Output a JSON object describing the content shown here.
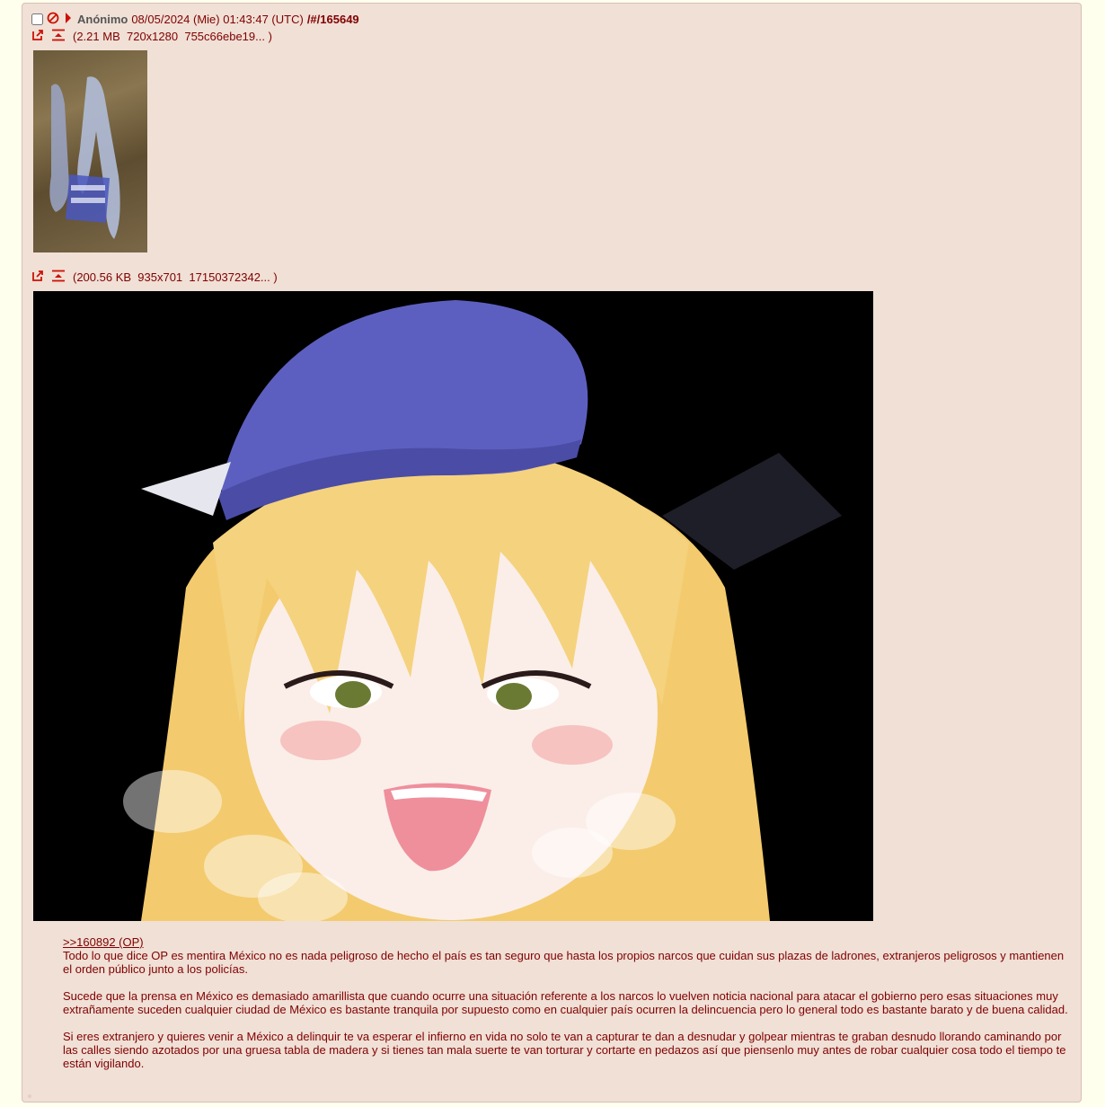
{
  "post": {
    "name": "Anónimo",
    "date": "08/05/2024 (Mie) 01:43:47 (UTC)",
    "number_prefix": "/#/",
    "number": "165649"
  },
  "files": [
    {
      "size": "(2.21 MB",
      "dims": "720x1280",
      "hash": "755c66ebe19...",
      "close": ")"
    },
    {
      "size": "(200.56 KB",
      "dims": "935x701",
      "hash": "17150372342...",
      "close": ")"
    }
  ],
  "body": {
    "quote": ">>160892 (OP)",
    "line1": "Todo lo que dice OP es mentira México no es nada peligroso de hecho el país es tan seguro que hasta los propios narcos que cuidan sus plazas de ladrones, extranjeros peligrosos y mantienen el orden público junto a los policías.",
    "para2": "Sucede que la prensa en México es demasiado amarillista que cuando ocurre una situación referente a los narcos lo vuelven noticia nacional para atacar el gobierno pero esas situaciones muy extrañamente suceden cualquier ciudad de México es bastante tranquila por supuesto como en cualquier país ocurren la delincuencia pero lo general todo es bastante barato y de buena calidad.",
    "para3": "Si eres extranjero y quieres venir a México a delinquir te va esperar el infierno en vida no solo te van a capturar te dan a desnudar y golpear mientras te graban desnudo llorando caminando por las calles siendo azotados por una gruesa tabla de madera y si tienes tan mala suerte te van torturar y cortarte en pedazos así que piensenlo muy antes de robar cualquier cosa todo el tiempo te están vigilando."
  },
  "colors": {
    "background": "#ffffee",
    "post_bg": "#f0e0d6",
    "text": "#800000",
    "name": "#555555",
    "icon_red": "#cc1105"
  }
}
